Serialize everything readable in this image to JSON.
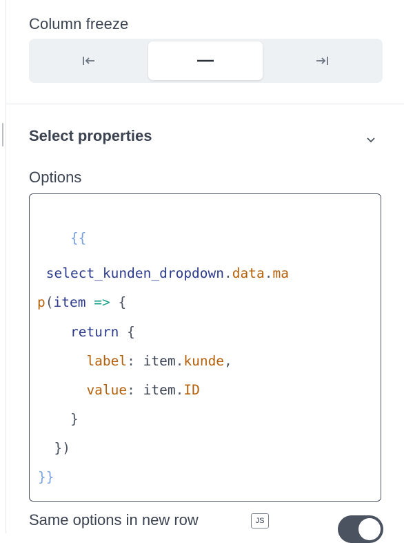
{
  "column_freeze": {
    "label": "Column freeze",
    "options": [
      {
        "icon": "freeze-left-icon",
        "selected": false
      },
      {
        "icon": "freeze-none-icon",
        "selected": true
      },
      {
        "icon": "freeze-right-icon",
        "selected": false
      }
    ]
  },
  "select_properties": {
    "title": "Select properties",
    "options_label": "Options",
    "code": {
      "l1": "{{",
      "l2_ident": " select_kunden_dropdown",
      "l2_dot1": ".",
      "l2_prop": "data",
      "l2_dot2": ".",
      "l2_ma": "ma",
      "l3_p": "p",
      "l3_paren": "(",
      "l3_item": "item",
      "l3_arrow": " => ",
      "l3_brace": "{",
      "l4_kw": "    return",
      "l4_brace": " {",
      "l5_key": "      label",
      "l5_colon": ": ",
      "l5_item": "item",
      "l5_dot": ".",
      "l5_prop": "kunde",
      "l5_comma": ",",
      "l6_key": "      value",
      "l6_colon": ": ",
      "l6_item": "item",
      "l6_dot": ".",
      "l6_prop": "ID",
      "l7": "    }",
      "l8": "  })",
      "l9": "}}"
    },
    "same_options_label": "Same options in new row",
    "js_badge": "JS",
    "same_options_enabled": true
  }
}
